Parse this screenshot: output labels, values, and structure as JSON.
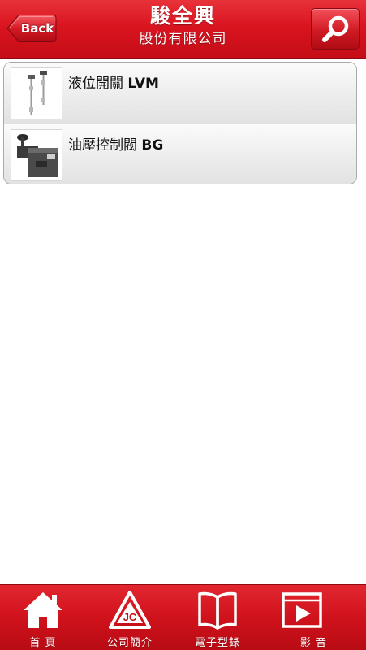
{
  "header": {
    "back_label": "Back",
    "title": "駿全興",
    "subtitle": "股份有限公司",
    "search_icon": "search-icon"
  },
  "list": {
    "items": [
      {
        "name": "液位開關",
        "code": "LVM",
        "thumbnail": "level-switch-product"
      },
      {
        "name": "油壓控制閥",
        "code": "BG",
        "thumbnail": "hydraulic-valve-product"
      }
    ]
  },
  "tabbar": {
    "tabs": [
      {
        "label": "首 頁",
        "icon": "home-icon"
      },
      {
        "label": "公司簡介",
        "icon": "company-logo-icon"
      },
      {
        "label": "電子型錄",
        "icon": "book-icon"
      },
      {
        "label": "影 音",
        "icon": "video-play-icon"
      }
    ]
  },
  "colors": {
    "brand_red": "#d9141f",
    "dark_red": "#8e0a10",
    "list_border": "#a9a9a9"
  }
}
